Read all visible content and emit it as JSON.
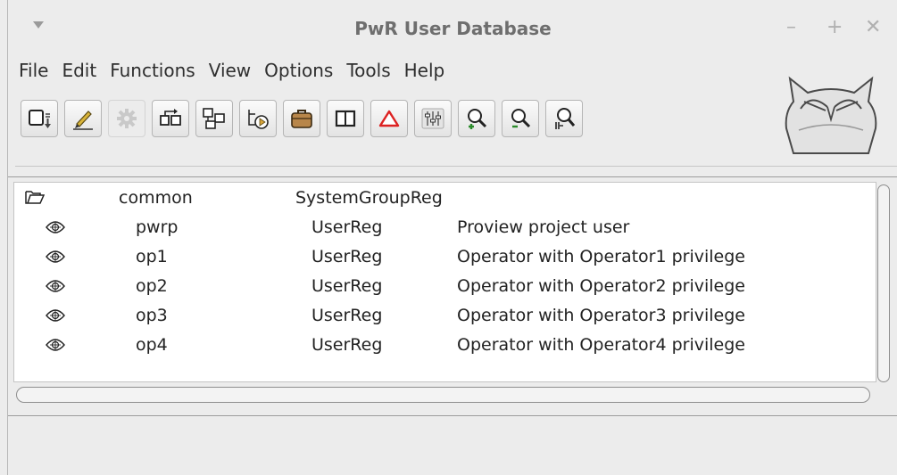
{
  "window": {
    "title": "PwR User Database",
    "controls": {
      "minimize": "–",
      "maximize": "+",
      "close": "✕"
    }
  },
  "menubar": {
    "items": [
      {
        "label": "File"
      },
      {
        "label": "Edit"
      },
      {
        "label": "Functions"
      },
      {
        "label": "View"
      },
      {
        "label": "Options"
      },
      {
        "label": "Tools"
      },
      {
        "label": "Help"
      }
    ]
  },
  "toolbar": {
    "buttons": [
      {
        "icon": "open-user-icon",
        "disabled": false
      },
      {
        "icon": "edit-pencil-icon",
        "disabled": false
      },
      {
        "icon": "gear-icon",
        "disabled": true
      },
      {
        "icon": "insert-object-icon",
        "disabled": false
      },
      {
        "icon": "insert-structure-icon",
        "disabled": false
      },
      {
        "icon": "move-icon",
        "disabled": false
      },
      {
        "icon": "briefcase-icon",
        "disabled": false
      },
      {
        "icon": "window-split-icon",
        "disabled": false
      },
      {
        "icon": "warning-triangle-icon",
        "disabled": false
      },
      {
        "icon": "equalizer-icon",
        "disabled": false
      },
      {
        "icon": "zoom-in-icon",
        "disabled": false
      },
      {
        "icon": "zoom-out-icon",
        "disabled": false
      },
      {
        "icon": "zoom-reset-icon",
        "disabled": false
      }
    ]
  },
  "tree": {
    "group": {
      "icon": "folder-icon",
      "name": "common",
      "class": "SystemGroupReg"
    },
    "users": [
      {
        "icon": "user-leaf-icon",
        "name": "pwrp",
        "class": "UserReg",
        "description": "Proview project user"
      },
      {
        "icon": "user-leaf-icon",
        "name": "op1",
        "class": "UserReg",
        "description": "Operator with Operator1 privilege"
      },
      {
        "icon": "user-leaf-icon",
        "name": "op2",
        "class": "UserReg",
        "description": "Operator with Operator2 privilege"
      },
      {
        "icon": "user-leaf-icon",
        "name": "op3",
        "class": "UserReg",
        "description": "Operator with Operator3 privilege"
      },
      {
        "icon": "user-leaf-icon",
        "name": "op4",
        "class": "UserReg",
        "description": "Operator with Operator4 privilege"
      }
    ]
  }
}
